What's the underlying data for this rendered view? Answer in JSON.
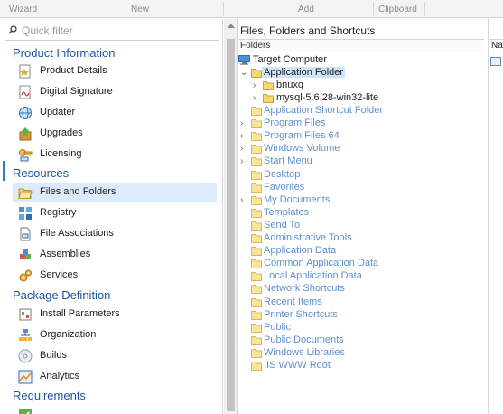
{
  "ribbon": {
    "groups": [
      "Wizard",
      "New",
      "Add",
      "Clipboard"
    ]
  },
  "sidebar": {
    "filter_placeholder": "Quick filter",
    "sections": [
      {
        "title": "Product Information",
        "items": [
          "Product Details",
          "Digital Signature",
          "Updater",
          "Upgrades",
          "Licensing"
        ]
      },
      {
        "title": "Resources",
        "items": [
          "Files and Folders",
          "Registry",
          "File Associations",
          "Assemblies",
          "Services"
        ]
      },
      {
        "title": "Package Definition",
        "items": [
          "Install Parameters",
          "Organization",
          "Builds",
          "Analytics"
        ]
      },
      {
        "title": "Requirements",
        "items": []
      }
    ],
    "selected_item": "Files and Folders"
  },
  "main": {
    "title": "Files, Folders and Shortcuts",
    "folders_header": "Folders",
    "tree": {
      "root": "Target Computer",
      "app_folder": "Application Folder",
      "app_children": [
        "bnuxq",
        "mysql-5.6.28-win32-lite"
      ],
      "items": [
        "Application Shortcut Folder",
        "Program Files",
        "Program Files 64",
        "Windows Volume",
        "Start Menu",
        "Desktop",
        "Favorites",
        "My Documents",
        "Templates",
        "Send To",
        "Administrative Tools",
        "Application Data",
        "Common Application Data",
        "Local Application Data",
        "Network Shortcuts",
        "Recent Items",
        "Printer Shortcuts",
        "Public",
        "Public Documents",
        "Windows Libraries",
        "IIS WWW Root"
      ]
    }
  },
  "right_panel": {
    "header": "Na"
  },
  "colors": {
    "accent": "#1e56a0",
    "selection": "#dcebfc",
    "folder": "#f6d870",
    "muted_link": "#5f8fd0"
  }
}
